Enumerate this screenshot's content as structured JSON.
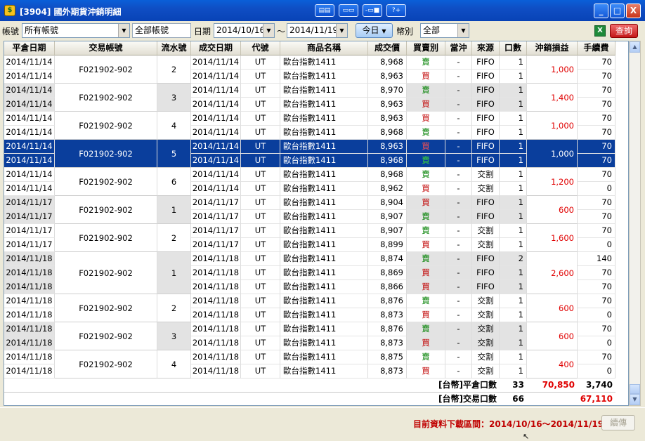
{
  "window": {
    "title": "[3904] 國外期貨沖銷明細",
    "min": "_",
    "max": "□",
    "close": "X"
  },
  "title_tools": [
    {
      "name": "layout-tool-1",
      "glyph": "▤▤"
    },
    {
      "name": "layout-tool-2",
      "glyph": "▭▭"
    },
    {
      "name": "layout-tool-3",
      "glyph": "-▭■"
    },
    {
      "name": "help-tool",
      "glyph": "?+"
    }
  ],
  "toolbar": {
    "account_label": "帳號",
    "account_value": "所有帳號",
    "account_name_value": "全部帳號",
    "date_label": "日期",
    "date_from": "2014/10/16",
    "tilde": "～",
    "date_to": "2014/11/19",
    "today_button": "今日",
    "currency_label": "幣別",
    "currency_value": "全部",
    "excel_icon": "X",
    "query_button": "查詢",
    "dropdown_arrow": "▼"
  },
  "columns": [
    "平倉日期",
    "交易帳號",
    "流水號",
    "成交日期",
    "代號",
    "商品名稱",
    "成交價",
    "買賣別",
    "當沖",
    "來源",
    "口數",
    "沖銷損益",
    "手續費"
  ],
  "groups": [
    {
      "account": "F021902-902",
      "serial": "2",
      "pnl": "1,000",
      "shade": false,
      "selected": false,
      "rows": [
        {
          "close_date": "2014/11/14",
          "trade_date": "2014/11/14",
          "symbol": "UT",
          "product": "歐台指數1411",
          "price": "8,968",
          "side": "賣",
          "side_type": "sell",
          "daytrade": "-",
          "source": "FIFO",
          "qty": "1",
          "fee": "70"
        },
        {
          "close_date": "2014/11/14",
          "trade_date": "2014/11/14",
          "symbol": "UT",
          "product": "歐台指數1411",
          "price": "8,963",
          "side": "買",
          "side_type": "buy",
          "daytrade": "-",
          "source": "FIFO",
          "qty": "1",
          "fee": "70"
        }
      ]
    },
    {
      "account": "F021902-902",
      "serial": "3",
      "pnl": "1,400",
      "shade": true,
      "selected": false,
      "rows": [
        {
          "close_date": "2014/11/14",
          "trade_date": "2014/11/14",
          "symbol": "UT",
          "product": "歐台指數1411",
          "price": "8,970",
          "side": "賣",
          "side_type": "sell",
          "daytrade": "-",
          "source": "FIFO",
          "qty": "1",
          "fee": "70"
        },
        {
          "close_date": "2014/11/14",
          "trade_date": "2014/11/14",
          "symbol": "UT",
          "product": "歐台指數1411",
          "price": "8,963",
          "side": "買",
          "side_type": "buy",
          "daytrade": "-",
          "source": "FIFO",
          "qty": "1",
          "fee": "70"
        }
      ]
    },
    {
      "account": "F021902-902",
      "serial": "4",
      "pnl": "1,000",
      "shade": false,
      "selected": false,
      "rows": [
        {
          "close_date": "2014/11/14",
          "trade_date": "2014/11/14",
          "symbol": "UT",
          "product": "歐台指數1411",
          "price": "8,963",
          "side": "買",
          "side_type": "buy",
          "daytrade": "-",
          "source": "FIFO",
          "qty": "1",
          "fee": "70"
        },
        {
          "close_date": "2014/11/14",
          "trade_date": "2014/11/14",
          "symbol": "UT",
          "product": "歐台指數1411",
          "price": "8,968",
          "side": "賣",
          "side_type": "sell",
          "daytrade": "-",
          "source": "FIFO",
          "qty": "1",
          "fee": "70"
        }
      ]
    },
    {
      "account": "F021902-902",
      "serial": "5",
      "pnl": "1,000",
      "shade": false,
      "selected": true,
      "rows": [
        {
          "close_date": "2014/11/14",
          "trade_date": "2014/11/14",
          "symbol": "UT",
          "product": "歐台指數1411",
          "price": "8,963",
          "side": "買",
          "side_type": "buy",
          "daytrade": "-",
          "source": "FIFO",
          "qty": "1",
          "fee": "70"
        },
        {
          "close_date": "2014/11/14",
          "trade_date": "2014/11/14",
          "symbol": "UT",
          "product": "歐台指數1411",
          "price": "8,968",
          "side": "賣",
          "side_type": "sell",
          "daytrade": "-",
          "source": "FIFO",
          "qty": "1",
          "fee": "70"
        }
      ]
    },
    {
      "account": "F021902-902",
      "serial": "6",
      "pnl": "1,200",
      "shade": false,
      "selected": false,
      "rows": [
        {
          "close_date": "2014/11/14",
          "trade_date": "2014/11/14",
          "symbol": "UT",
          "product": "歐台指數1411",
          "price": "8,968",
          "side": "賣",
          "side_type": "sell",
          "daytrade": "-",
          "source": "交割",
          "qty": "1",
          "fee": "70"
        },
        {
          "close_date": "2014/11/14",
          "trade_date": "2014/11/14",
          "symbol": "UT",
          "product": "歐台指數1411",
          "price": "8,962",
          "side": "買",
          "side_type": "buy",
          "daytrade": "-",
          "source": "交割",
          "qty": "1",
          "fee": "0"
        }
      ]
    },
    {
      "account": "F021902-902",
      "serial": "1",
      "pnl": "600",
      "shade": true,
      "selected": false,
      "rows": [
        {
          "close_date": "2014/11/17",
          "trade_date": "2014/11/17",
          "symbol": "UT",
          "product": "歐台指數1411",
          "price": "8,904",
          "side": "買",
          "side_type": "buy",
          "daytrade": "-",
          "source": "FIFO",
          "qty": "1",
          "fee": "70"
        },
        {
          "close_date": "2014/11/17",
          "trade_date": "2014/11/17",
          "symbol": "UT",
          "product": "歐台指數1411",
          "price": "8,907",
          "side": "賣",
          "side_type": "sell",
          "daytrade": "-",
          "source": "FIFO",
          "qty": "1",
          "fee": "70"
        }
      ]
    },
    {
      "account": "F021902-902",
      "serial": "2",
      "pnl": "1,600",
      "shade": false,
      "selected": false,
      "rows": [
        {
          "close_date": "2014/11/17",
          "trade_date": "2014/11/17",
          "symbol": "UT",
          "product": "歐台指數1411",
          "price": "8,907",
          "side": "賣",
          "side_type": "sell",
          "daytrade": "-",
          "source": "交割",
          "qty": "1",
          "fee": "70"
        },
        {
          "close_date": "2014/11/17",
          "trade_date": "2014/11/17",
          "symbol": "UT",
          "product": "歐台指數1411",
          "price": "8,899",
          "side": "買",
          "side_type": "buy",
          "daytrade": "-",
          "source": "交割",
          "qty": "1",
          "fee": "0"
        }
      ]
    },
    {
      "account": "F021902-902",
      "serial": "1",
      "pnl": "2,600",
      "shade": true,
      "selected": false,
      "rows": [
        {
          "close_date": "2014/11/18",
          "trade_date": "2014/11/18",
          "symbol": "UT",
          "product": "歐台指數1411",
          "price": "8,874",
          "side": "賣",
          "side_type": "sell",
          "daytrade": "-",
          "source": "FIFO",
          "qty": "2",
          "fee": "140"
        },
        {
          "close_date": "2014/11/18",
          "trade_date": "2014/11/18",
          "symbol": "UT",
          "product": "歐台指數1411",
          "price": "8,869",
          "side": "買",
          "side_type": "buy",
          "daytrade": "-",
          "source": "FIFO",
          "qty": "1",
          "fee": "70"
        },
        {
          "close_date": "2014/11/18",
          "trade_date": "2014/11/18",
          "symbol": "UT",
          "product": "歐台指數1411",
          "price": "8,866",
          "side": "買",
          "side_type": "buy",
          "daytrade": "-",
          "source": "FIFO",
          "qty": "1",
          "fee": "70"
        }
      ]
    },
    {
      "account": "F021902-902",
      "serial": "2",
      "pnl": "600",
      "shade": false,
      "selected": false,
      "rows": [
        {
          "close_date": "2014/11/18",
          "trade_date": "2014/11/18",
          "symbol": "UT",
          "product": "歐台指數1411",
          "price": "8,876",
          "side": "賣",
          "side_type": "sell",
          "daytrade": "-",
          "source": "交割",
          "qty": "1",
          "fee": "70"
        },
        {
          "close_date": "2014/11/18",
          "trade_date": "2014/11/18",
          "symbol": "UT",
          "product": "歐台指數1411",
          "price": "8,873",
          "side": "買",
          "side_type": "buy",
          "daytrade": "-",
          "source": "交割",
          "qty": "1",
          "fee": "0"
        }
      ]
    },
    {
      "account": "F021902-902",
      "serial": "3",
      "pnl": "600",
      "shade": true,
      "selected": false,
      "rows": [
        {
          "close_date": "2014/11/18",
          "trade_date": "2014/11/18",
          "symbol": "UT",
          "product": "歐台指數1411",
          "price": "8,876",
          "side": "賣",
          "side_type": "sell",
          "daytrade": "-",
          "source": "交割",
          "qty": "1",
          "fee": "70"
        },
        {
          "close_date": "2014/11/18",
          "trade_date": "2014/11/18",
          "symbol": "UT",
          "product": "歐台指數1411",
          "price": "8,873",
          "side": "買",
          "side_type": "buy",
          "daytrade": "-",
          "source": "交割",
          "qty": "1",
          "fee": "0"
        }
      ]
    },
    {
      "account": "F021902-902",
      "serial": "4",
      "pnl": "400",
      "shade": false,
      "selected": false,
      "rows": [
        {
          "close_date": "2014/11/18",
          "trade_date": "2014/11/18",
          "symbol": "UT",
          "product": "歐台指數1411",
          "price": "8,875",
          "side": "賣",
          "side_type": "sell",
          "daytrade": "-",
          "source": "交割",
          "qty": "1",
          "fee": "70"
        },
        {
          "close_date": "2014/11/18",
          "trade_date": "2014/11/18",
          "symbol": "UT",
          "product": "歐台指數1411",
          "price": "8,873",
          "side": "買",
          "side_type": "buy",
          "daytrade": "-",
          "source": "交割",
          "qty": "1",
          "fee": "0"
        }
      ]
    }
  ],
  "summary": {
    "close_label": "[台幣]平倉口數",
    "close_qty": "33",
    "close_pnl": "70,850",
    "close_fee": "3,740",
    "trade_label": "[台幣]交易口數",
    "trade_qty": "66",
    "trade_net": "67,110"
  },
  "status": {
    "download_range": "目前資料下載區間：2014/10/16～2014/11/19",
    "resume_button": "續傳"
  },
  "colors": {
    "selected_row": "#0a3e9c",
    "buy": "#c00000",
    "sell": "#008000",
    "pnl": "#e00000"
  },
  "scroll_glyphs": {
    "up": "▲",
    "down": "▼"
  },
  "cursor_glyph": "↖"
}
